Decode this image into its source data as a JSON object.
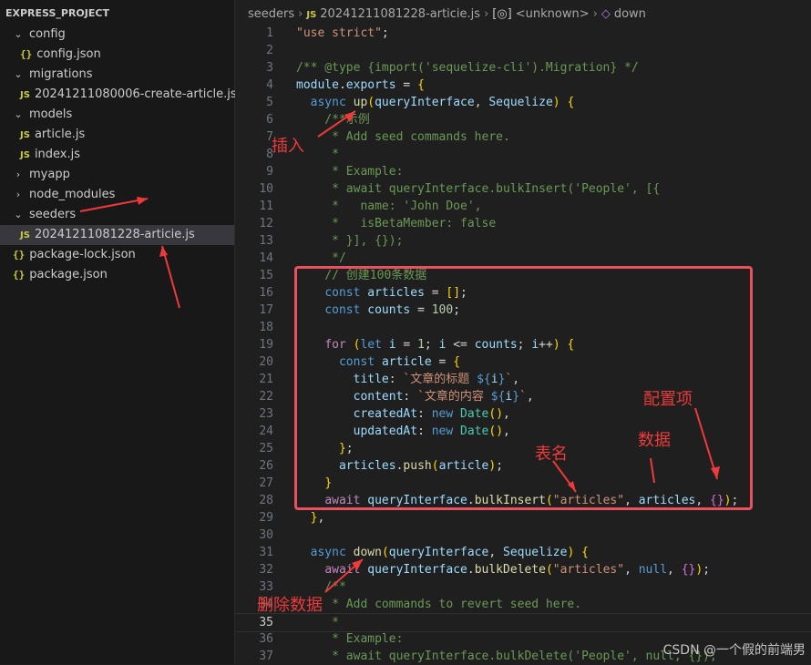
{
  "explorer": {
    "project_title": "EXPRESS_PROJECT",
    "items": [
      {
        "label": "config",
        "kind": "folder"
      },
      {
        "label": "config.json",
        "kind": "json"
      },
      {
        "label": "migrations",
        "kind": "folder"
      },
      {
        "label": "20241211080006-create-article.js",
        "kind": "js"
      },
      {
        "label": "models",
        "kind": "folder"
      },
      {
        "label": "article.js",
        "kind": "js"
      },
      {
        "label": "index.js",
        "kind": "js"
      },
      {
        "label": "myapp",
        "kind": "folder-collapsed"
      },
      {
        "label": "node_modules",
        "kind": "folder-collapsed"
      },
      {
        "label": "seeders",
        "kind": "folder"
      },
      {
        "label": "20241211081228-articie.js",
        "kind": "js",
        "selected": true
      },
      {
        "label": "package-lock.json",
        "kind": "json"
      },
      {
        "label": "package.json",
        "kind": "json"
      }
    ],
    "js_badge": "JS",
    "json_badge": "{}"
  },
  "breadcrumb": {
    "folder": "seeders",
    "file": "20241211081228-articie.js",
    "symbol1": "<unknown>",
    "symbol2": "down"
  },
  "editor": {
    "current_line": 35,
    "lines": [
      {
        "n": "1",
        "text": "\"use strict\";"
      },
      {
        "n": "2",
        "text": ""
      },
      {
        "n": "3",
        "text": "/** @type {import('sequelize-cli').Migration} */"
      },
      {
        "n": "4",
        "text": "module.exports = {"
      },
      {
        "n": "5",
        "text": "  async up(queryInterface, Sequelize) {"
      },
      {
        "n": "6",
        "text": "    /**示例"
      },
      {
        "n": "7",
        "text": "     * Add seed commands here."
      },
      {
        "n": "8",
        "text": "     *"
      },
      {
        "n": "9",
        "text": "     * Example:"
      },
      {
        "n": "10",
        "text": "     * await queryInterface.bulkInsert('People', [{"
      },
      {
        "n": "11",
        "text": "     *   name: 'John Doe',"
      },
      {
        "n": "12",
        "text": "     *   isBetaMember: false"
      },
      {
        "n": "13",
        "text": "     * }], {});"
      },
      {
        "n": "14",
        "text": "     */"
      },
      {
        "n": "15",
        "text": "    // 创建100条数据"
      },
      {
        "n": "16",
        "text": "    const articles = [];"
      },
      {
        "n": "17",
        "text": "    const counts = 100;"
      },
      {
        "n": "18",
        "text": ""
      },
      {
        "n": "19",
        "text": "    for (let i = 1; i <= counts; i++) {"
      },
      {
        "n": "20",
        "text": "      const article = {"
      },
      {
        "n": "21",
        "text": "        title: `文章的标题 ${i}`,"
      },
      {
        "n": "22",
        "text": "        content: `文章的内容 ${i}`,"
      },
      {
        "n": "23",
        "text": "        createdAt: new Date(),"
      },
      {
        "n": "24",
        "text": "        updatedAt: new Date(),"
      },
      {
        "n": "25",
        "text": "      };"
      },
      {
        "n": "26",
        "text": "      articles.push(article);"
      },
      {
        "n": "27",
        "text": "    }"
      },
      {
        "n": "28",
        "text": "    await queryInterface.bulkInsert(\"articles\", articles, {});"
      },
      {
        "n": "29",
        "text": "  },"
      },
      {
        "n": "30",
        "text": ""
      },
      {
        "n": "31",
        "text": "  async down(queryInterface, Sequelize) {"
      },
      {
        "n": "32",
        "text": "    await queryInterface.bulkDelete(\"articles\", null, {});"
      },
      {
        "n": "33",
        "text": "    /**"
      },
      {
        "n": "34",
        "text": "     * Add commands to revert seed here."
      },
      {
        "n": "35",
        "text": "     *"
      },
      {
        "n": "36",
        "text": "     * Example:"
      },
      {
        "n": "37",
        "text": "     * await queryInterface.bulkDelete('People', null, {});"
      }
    ]
  },
  "annotations": {
    "insert": "插入",
    "delete_data": "删除数据",
    "table_name": "表名",
    "data": "数据",
    "config_item": "配置项"
  },
  "watermark": "CSDN @一个假的前端男",
  "colors": {
    "annotation": "#ee3a3a",
    "box": "#e8515d"
  }
}
